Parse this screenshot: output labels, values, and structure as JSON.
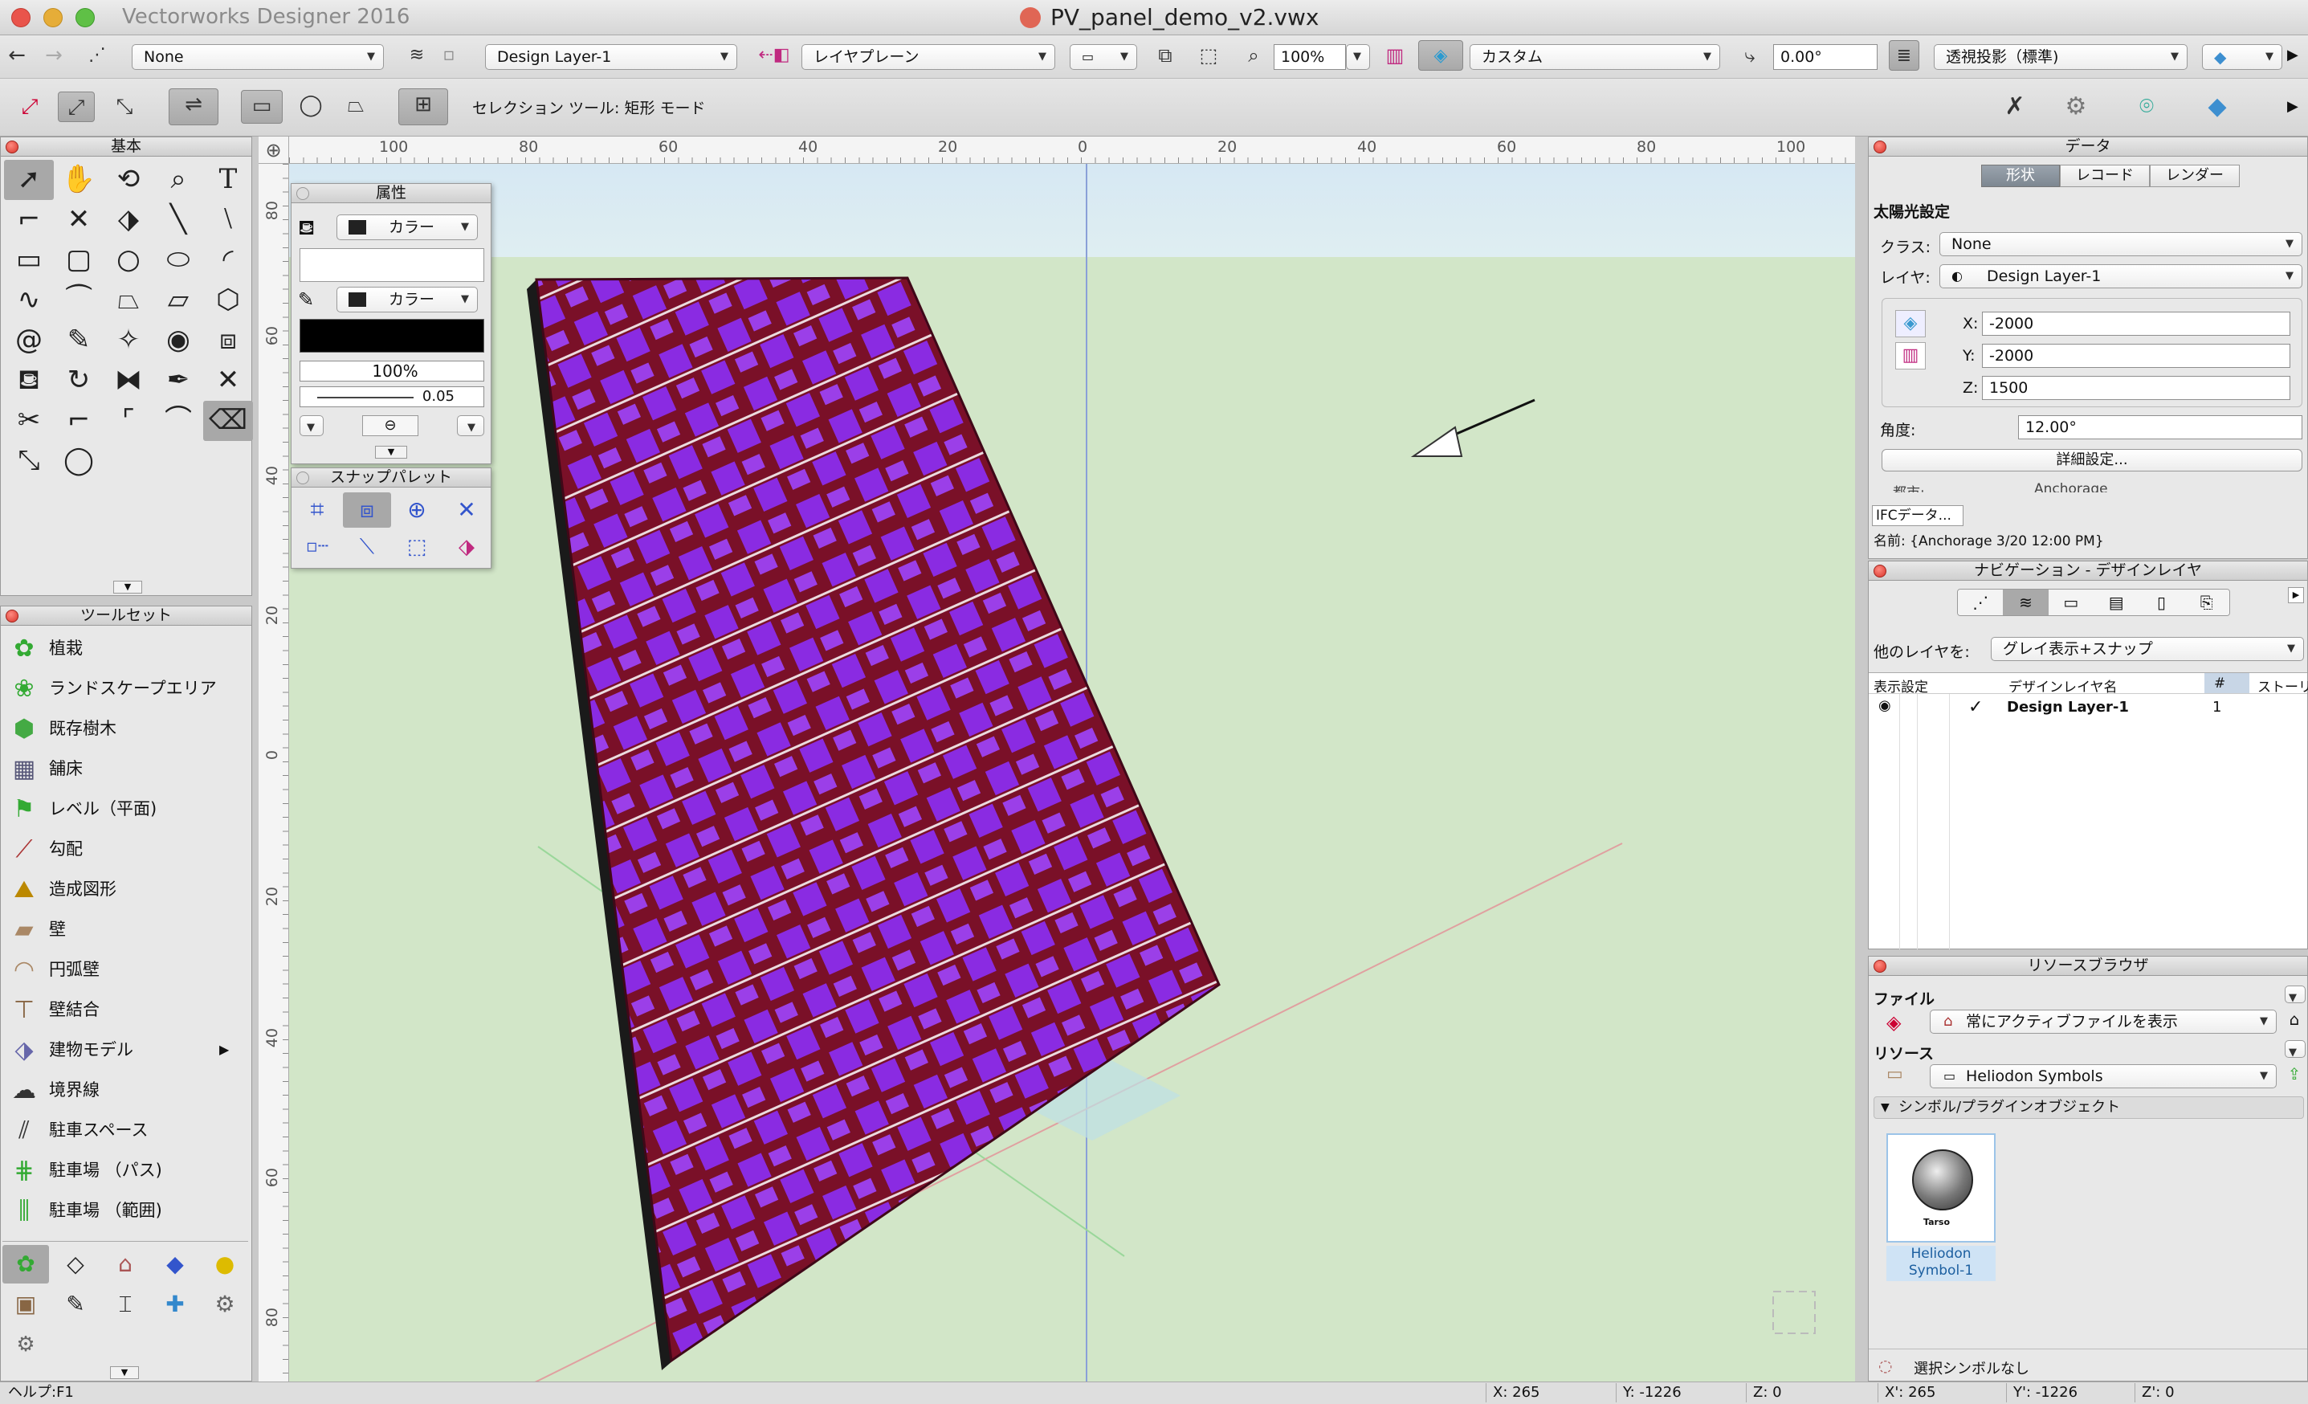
{
  "window": {
    "app_title": "Vectorworks Designer 2016",
    "doc_title": "PV_panel_demo_v2.vwx"
  },
  "toolbar1": {
    "class": "None",
    "layer": "Design Layer-1",
    "plane": "レイヤプレーン",
    "zoom": "100%",
    "view": "カスタム",
    "angle": "0.00°",
    "render": "透視投影（標準)"
  },
  "toolbar2": {
    "mode_text": "セレクション ツール: 矩形 モード"
  },
  "palette_basic": {
    "title": "基本"
  },
  "palette_toolsets": {
    "title": "ツールセット",
    "items": [
      "植栽",
      "ランドスケープエリア",
      "既存樹木",
      "舗床",
      "レベル（平面)",
      "勾配",
      "造成図形",
      "壁",
      "円弧壁",
      "壁結合",
      "建物モデル",
      "境界線",
      "駐車スペース",
      "駐車場 （パス)",
      "駐車場 （範囲)"
    ]
  },
  "attributes": {
    "title": "属性",
    "fill": "カラー",
    "pen": "カラー",
    "opacity": "100%",
    "line_weight": "0.05"
  },
  "snap": {
    "title": "スナップパレット"
  },
  "rulers": {
    "top": [
      "100",
      "80",
      "60",
      "40",
      "20",
      "0",
      "20",
      "40",
      "60",
      "80",
      "100"
    ],
    "left": [
      "80",
      "60",
      "40",
      "20",
      "0",
      "20",
      "40",
      "60",
      "80"
    ]
  },
  "data_palette": {
    "title": "データ",
    "tabs": [
      "形状",
      "レコード",
      "レンダー"
    ],
    "object": "太陽光設定",
    "class_label": "クラス:",
    "class_value": "None",
    "layer_label": "レイヤ:",
    "layer_value": "Design Layer-1",
    "x_label": "X:",
    "x_value": "-2000",
    "y_label": "Y:",
    "y_value": "-2000",
    "z_label": "Z:",
    "z_value": "1500",
    "angle_label": "角度:",
    "angle_value": "12.00°",
    "detail_button": "詳細設定...",
    "city_label": "都市:",
    "city_value": "Anchorage",
    "ifc_button": "IFCデータ...",
    "name_label": "名前: {Anchorage 3/20 12:00 PM}"
  },
  "navigation": {
    "title": "ナビゲーション - デザインレイヤ",
    "other_layers_label": "他のレイヤを:",
    "other_layers_value": "グレイ表示+スナップ",
    "col_display": "表示設定",
    "col_name": "デザインレイヤ名",
    "col_num": "#",
    "col_story": "ストーリ",
    "row_name": "Design Layer-1",
    "row_num": "1",
    "row_check": "✓"
  },
  "resources": {
    "title": "リソースブラウザ",
    "file_label": "ファイル",
    "file_value": "常にアクティブファイルを表示",
    "resource_label": "リソース",
    "resource_value": "Heliodon Symbols",
    "section": "シンボル/プラグインオブジェクト",
    "symbol_name1": "Heliodon",
    "symbol_name2": "Symbol-1",
    "symbol_badge": "Tarso",
    "footer": "選択シンボルなし"
  },
  "status": {
    "help": "ヘルプ:F1",
    "x1": "X: 265",
    "y1": "Y: -1226",
    "z1": "Z: 0",
    "x2": "X': 265",
    "y2": "Y': -1226",
    "z2": "Z': 0"
  },
  "colors": {
    "panel_purple": "#8a2be2",
    "panel_dark_red": "#7a1028",
    "grid_white": "#ffffff",
    "sky": "#dbe9f1",
    "ground": "#d2e6c8"
  }
}
